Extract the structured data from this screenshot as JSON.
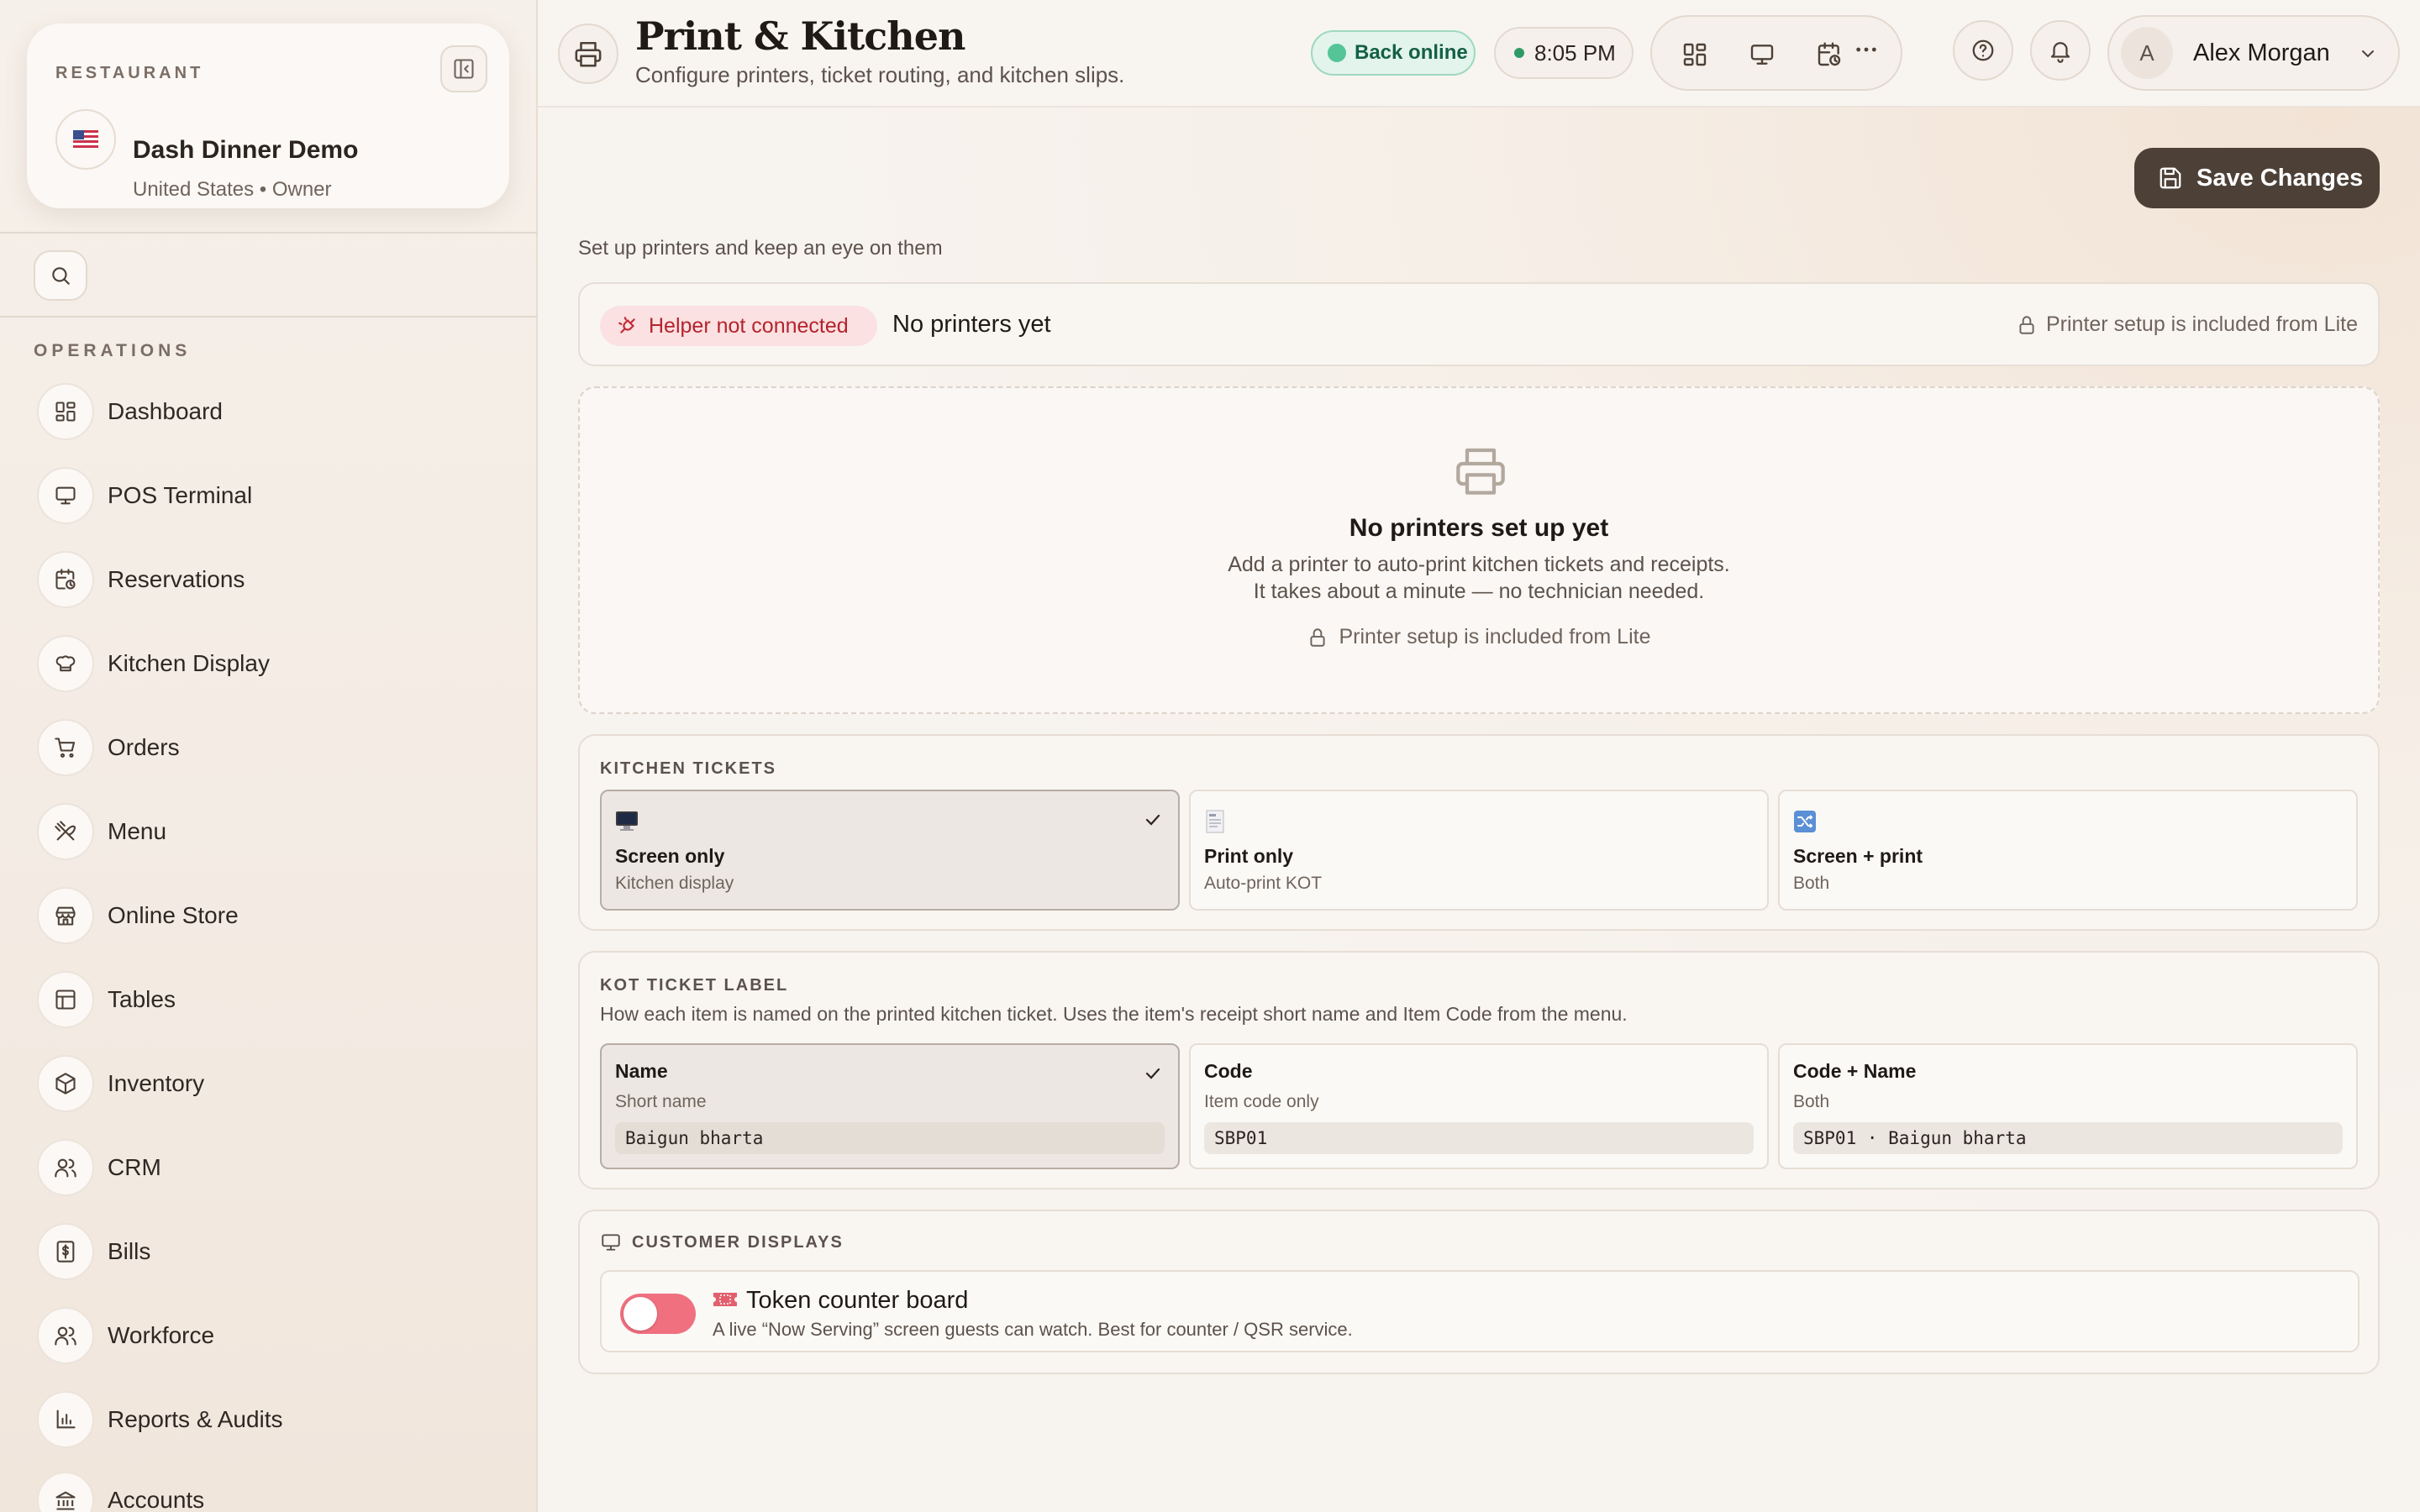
{
  "sidebar": {
    "restaurant_label": "RESTAURANT",
    "restaurant_name": "Dash Dinner Demo",
    "restaurant_sub": "United States • Owner",
    "section_label": "OPERATIONS",
    "items": [
      {
        "label": "Dashboard",
        "icon": "grid-icon"
      },
      {
        "label": "POS Terminal",
        "icon": "monitor-icon"
      },
      {
        "label": "Reservations",
        "icon": "calendar-clock-icon"
      },
      {
        "label": "Kitchen Display",
        "icon": "chef-hat-icon"
      },
      {
        "label": "Orders",
        "icon": "cart-icon"
      },
      {
        "label": "Menu",
        "icon": "utensils-icon"
      },
      {
        "label": "Online Store",
        "icon": "store-icon"
      },
      {
        "label": "Tables",
        "icon": "table-icon"
      },
      {
        "label": "Inventory",
        "icon": "package-icon"
      },
      {
        "label": "CRM",
        "icon": "users-icon"
      },
      {
        "label": "Bills",
        "icon": "receipt-icon"
      },
      {
        "label": "Workforce",
        "icon": "team-icon"
      },
      {
        "label": "Reports & Audits",
        "icon": "bar-chart-icon"
      },
      {
        "label": "Accounts",
        "icon": "bank-icon"
      }
    ]
  },
  "header": {
    "title": "Print & Kitchen",
    "subtitle": "Configure printers, ticket routing, and kitchen slips.",
    "status": "Back online",
    "time": "8:05 PM",
    "user_initial": "A",
    "user_name": "Alex Morgan"
  },
  "main": {
    "save_label": "Save Changes",
    "intro": "Set up printers and keep an eye on them",
    "helper_status": "Helper not connected",
    "no_printers": "No printers yet",
    "lite_note": "Printer setup is included from Lite",
    "empty": {
      "title": "No printers set up yet",
      "line1": "Add a printer to auto-print kitchen tickets and receipts.",
      "line2": "It takes about a minute — no technician needed.",
      "lite": "Printer setup is included from Lite"
    },
    "kitchen_tickets": {
      "label": "KITCHEN TICKETS",
      "options": [
        {
          "title": "Screen only",
          "sub": "Kitchen display",
          "selected": true
        },
        {
          "title": "Print only",
          "sub": "Auto-print KOT",
          "selected": false
        },
        {
          "title": "Screen + print",
          "sub": "Both",
          "selected": false
        }
      ]
    },
    "kot_label": {
      "label": "KOT TICKET LABEL",
      "desc": "How each item is named on the printed kitchen ticket. Uses the item's receipt short name and Item Code from the menu.",
      "options": [
        {
          "title": "Name",
          "sub": "Short name",
          "example": "Baigun bharta",
          "selected": true
        },
        {
          "title": "Code",
          "sub": "Item code only",
          "example": "SBP01",
          "selected": false
        },
        {
          "title": "Code + Name",
          "sub": "Both",
          "example": "SBP01 · Baigun bharta",
          "selected": false
        }
      ]
    },
    "customer_displays": {
      "label": "CUSTOMER DISPLAYS",
      "token_title": "Token counter board",
      "token_desc": "A live “Now Serving” screen guests can watch. Best for counter / QSR service.",
      "token_enabled": false
    }
  },
  "colors": {
    "accent_dark": "#4d4037",
    "online_green": "#55c597",
    "helper_red": "#b5232e",
    "toggle_pink": "#f0707f"
  }
}
